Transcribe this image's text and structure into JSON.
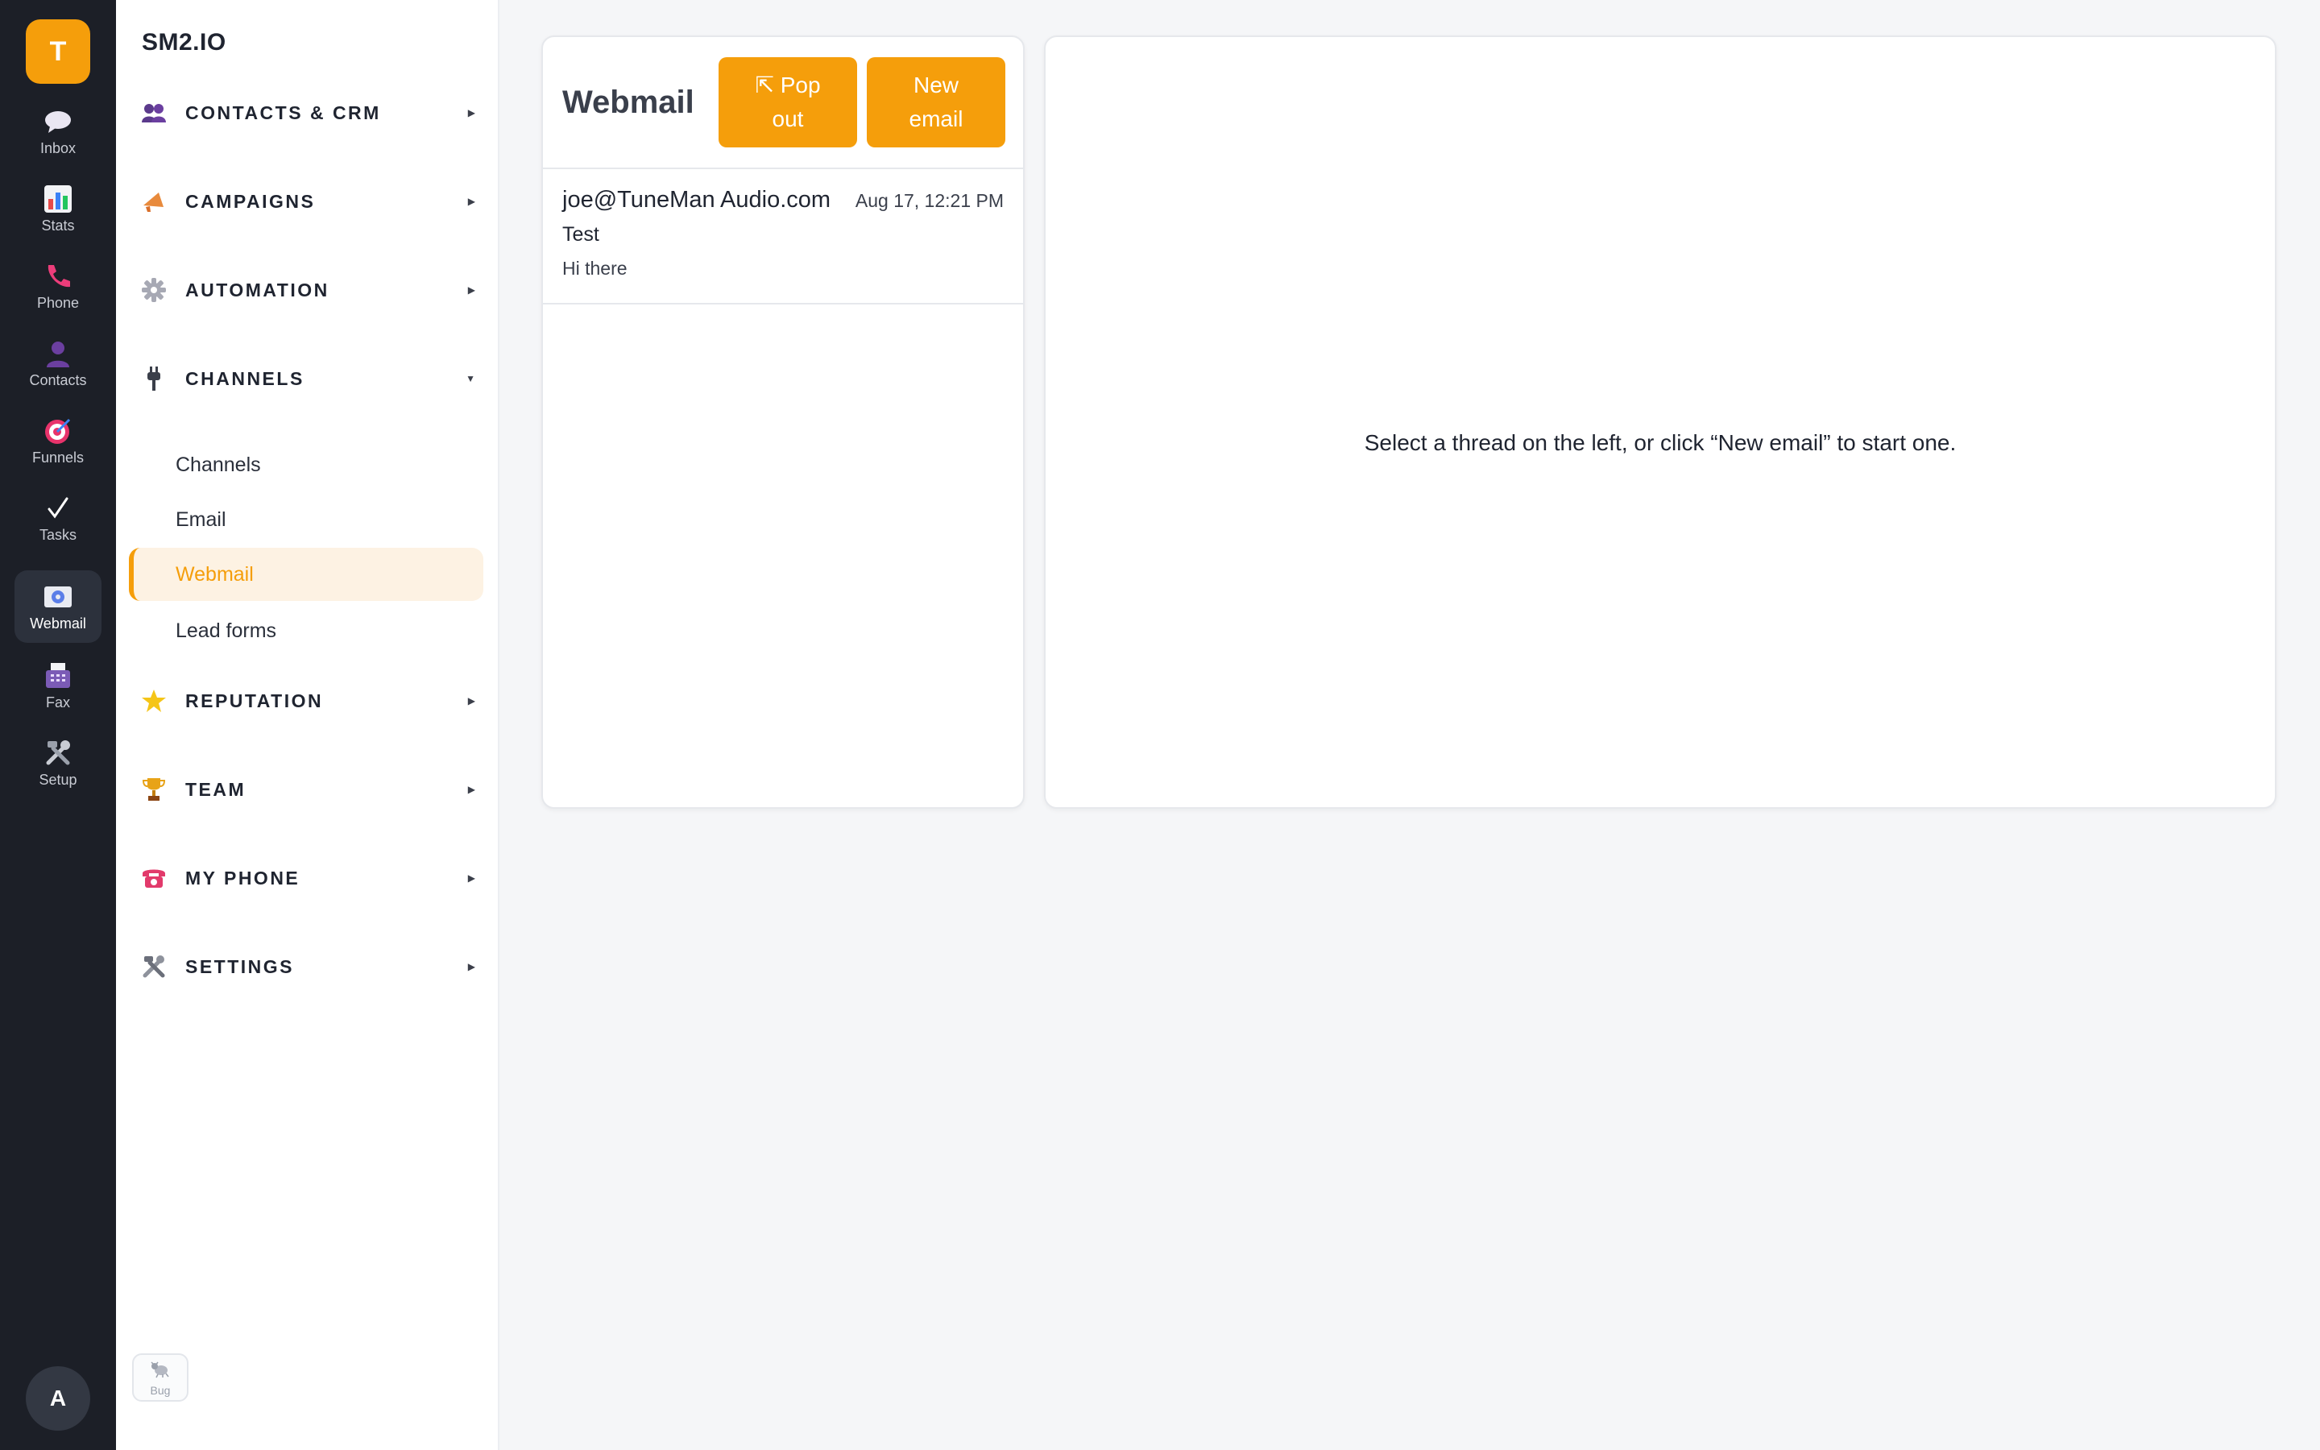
{
  "rail": {
    "logo_letter": "T",
    "items": [
      {
        "label": "Inbox",
        "icon": "speech-bubble-icon"
      },
      {
        "label": "Stats",
        "icon": "bar-chart-icon"
      },
      {
        "label": "Phone",
        "icon": "phone-icon"
      },
      {
        "label": "Contacts",
        "icon": "person-icon"
      },
      {
        "label": "Funnels",
        "icon": "target-icon"
      },
      {
        "label": "Tasks",
        "icon": "checkmark-icon"
      },
      {
        "label": "Webmail",
        "icon": "at-sign-icon"
      },
      {
        "label": "Fax",
        "icon": "fax-icon"
      },
      {
        "label": "Setup",
        "icon": "tools-icon"
      }
    ],
    "active": "Webmail",
    "avatar_letter": "A"
  },
  "sidebar": {
    "brand": "SM2.IO",
    "sections": [
      {
        "label": "CONTACTS & CRM",
        "icon": "people-icon",
        "expanded": false
      },
      {
        "label": "CAMPAIGNS",
        "icon": "megaphone-icon",
        "expanded": false
      },
      {
        "label": "AUTOMATION",
        "icon": "gear-icon",
        "expanded": false
      },
      {
        "label": "CHANNELS",
        "icon": "plug-icon",
        "expanded": true
      },
      {
        "label": "REPUTATION",
        "icon": "star-icon",
        "expanded": false
      },
      {
        "label": "TEAM",
        "icon": "trophy-icon",
        "expanded": false
      },
      {
        "label": "MY PHONE",
        "icon": "telephone-icon",
        "expanded": false
      },
      {
        "label": "SETTINGS",
        "icon": "tools-icon",
        "expanded": false
      }
    ],
    "channel_items": [
      "Channels",
      "Email",
      "Webmail",
      "Lead forms"
    ],
    "active_item": "Webmail",
    "bug_label": "Bug"
  },
  "webmail": {
    "title": "Webmail",
    "popout_label": "⇱ Pop out",
    "new_email_label": "New email",
    "threads": [
      {
        "from": "joe@TuneMan Audio.com",
        "date": "Aug 17, 12:21 PM",
        "subject": "Test",
        "preview": "Hi there"
      }
    ],
    "empty_message": "Select a thread on the left, or click “New email” to start one."
  },
  "colors": {
    "accent": "#f59e0b",
    "rail_bg": "#1c1f27",
    "page_bg": "#f5f6f8"
  }
}
